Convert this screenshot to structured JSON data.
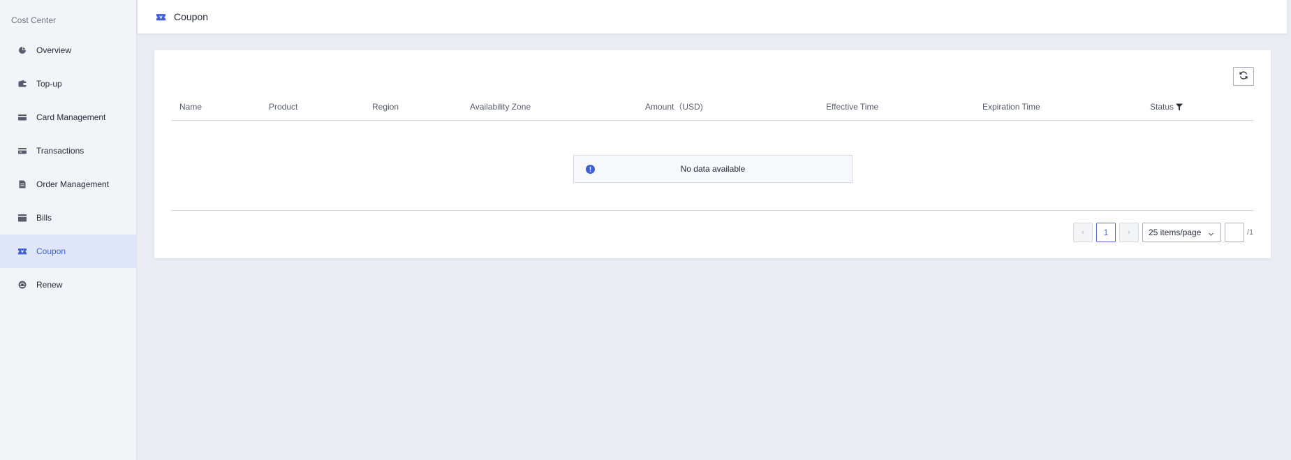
{
  "sidebar": {
    "title": "Cost Center",
    "items": [
      {
        "label": "Overview",
        "icon": "pie-chart-icon"
      },
      {
        "label": "Top-up",
        "icon": "wallet-icon"
      },
      {
        "label": "Card Management",
        "icon": "card-icon"
      },
      {
        "label": "Transactions",
        "icon": "transactions-icon"
      },
      {
        "label": "Order Management",
        "icon": "order-icon"
      },
      {
        "label": "Bills",
        "icon": "bills-icon"
      },
      {
        "label": "Coupon",
        "icon": "coupon-icon",
        "active": true
      },
      {
        "label": "Renew",
        "icon": "renew-icon"
      }
    ]
  },
  "header": {
    "title": "Coupon"
  },
  "table": {
    "columns": [
      "Name",
      "Product",
      "Region",
      "Availability Zone",
      "Amount（USD)",
      "Effective Time",
      "Expiration Time",
      "Status"
    ],
    "empty_text": "No data available"
  },
  "pagination": {
    "prev": "‹",
    "current_page": "1",
    "next": "›",
    "page_size": "25 items/page",
    "total_pages": "/1"
  },
  "colors": {
    "accent": "#526ecc",
    "active_bg": "#e0e6fa",
    "page_bg": "#e9ecf3",
    "info": "#3f5fd6"
  }
}
